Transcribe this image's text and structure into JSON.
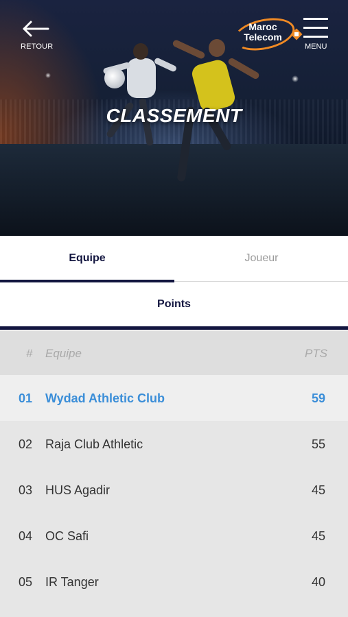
{
  "header": {
    "back_label": "RETOUR",
    "menu_label": "MENU",
    "title": "CLASSEMENT",
    "logo": {
      "line1": "Maroc",
      "line2": "Telecom",
      "accent_color": "#f08a24"
    },
    "icons": {
      "back": "arrow-left-icon",
      "menu": "hamburger-menu-icon"
    }
  },
  "tabs": [
    {
      "label": "Equipe",
      "active": true
    },
    {
      "label": "Joueur",
      "active": false
    }
  ],
  "subtab": {
    "label": "Points"
  },
  "table": {
    "headers": {
      "rank": "#",
      "team": "Equipe",
      "points": "PTS"
    },
    "rows": [
      {
        "rank": "01",
        "team": "Wydad Athletic Club",
        "points": "59",
        "highlighted": true
      },
      {
        "rank": "02",
        "team": "Raja Club Athletic",
        "points": "55",
        "highlighted": false
      },
      {
        "rank": "03",
        "team": "HUS Agadir",
        "points": "45",
        "highlighted": false
      },
      {
        "rank": "04",
        "team": "OC Safi",
        "points": "45",
        "highlighted": false
      },
      {
        "rank": "05",
        "team": "IR Tanger",
        "points": "40",
        "highlighted": false
      }
    ]
  },
  "colors": {
    "primary": "#12153f",
    "highlight_text": "#3b8ed8",
    "row_background": "#e6e6e6",
    "header_background": "#dedede"
  }
}
